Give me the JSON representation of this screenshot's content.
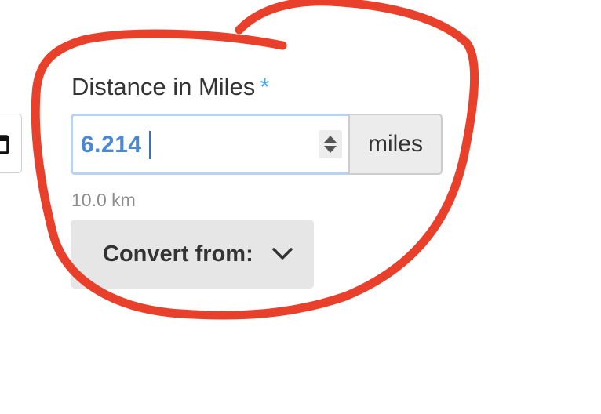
{
  "field": {
    "label": "Distance in Miles",
    "required_mark": "*",
    "value": "6.214",
    "unit": "miles",
    "helper": "10.0 km"
  },
  "convert": {
    "label": "Convert from:"
  },
  "colors": {
    "required_star": "#4fa3dd",
    "input_value": "#4a88d6",
    "focus_border": "#b8d2f2",
    "annotation": "#e8402a"
  },
  "icons": {
    "left_widget": "calendar-icon",
    "spinner": "number-spinner-icon",
    "dropdown": "chevron-down-icon"
  }
}
